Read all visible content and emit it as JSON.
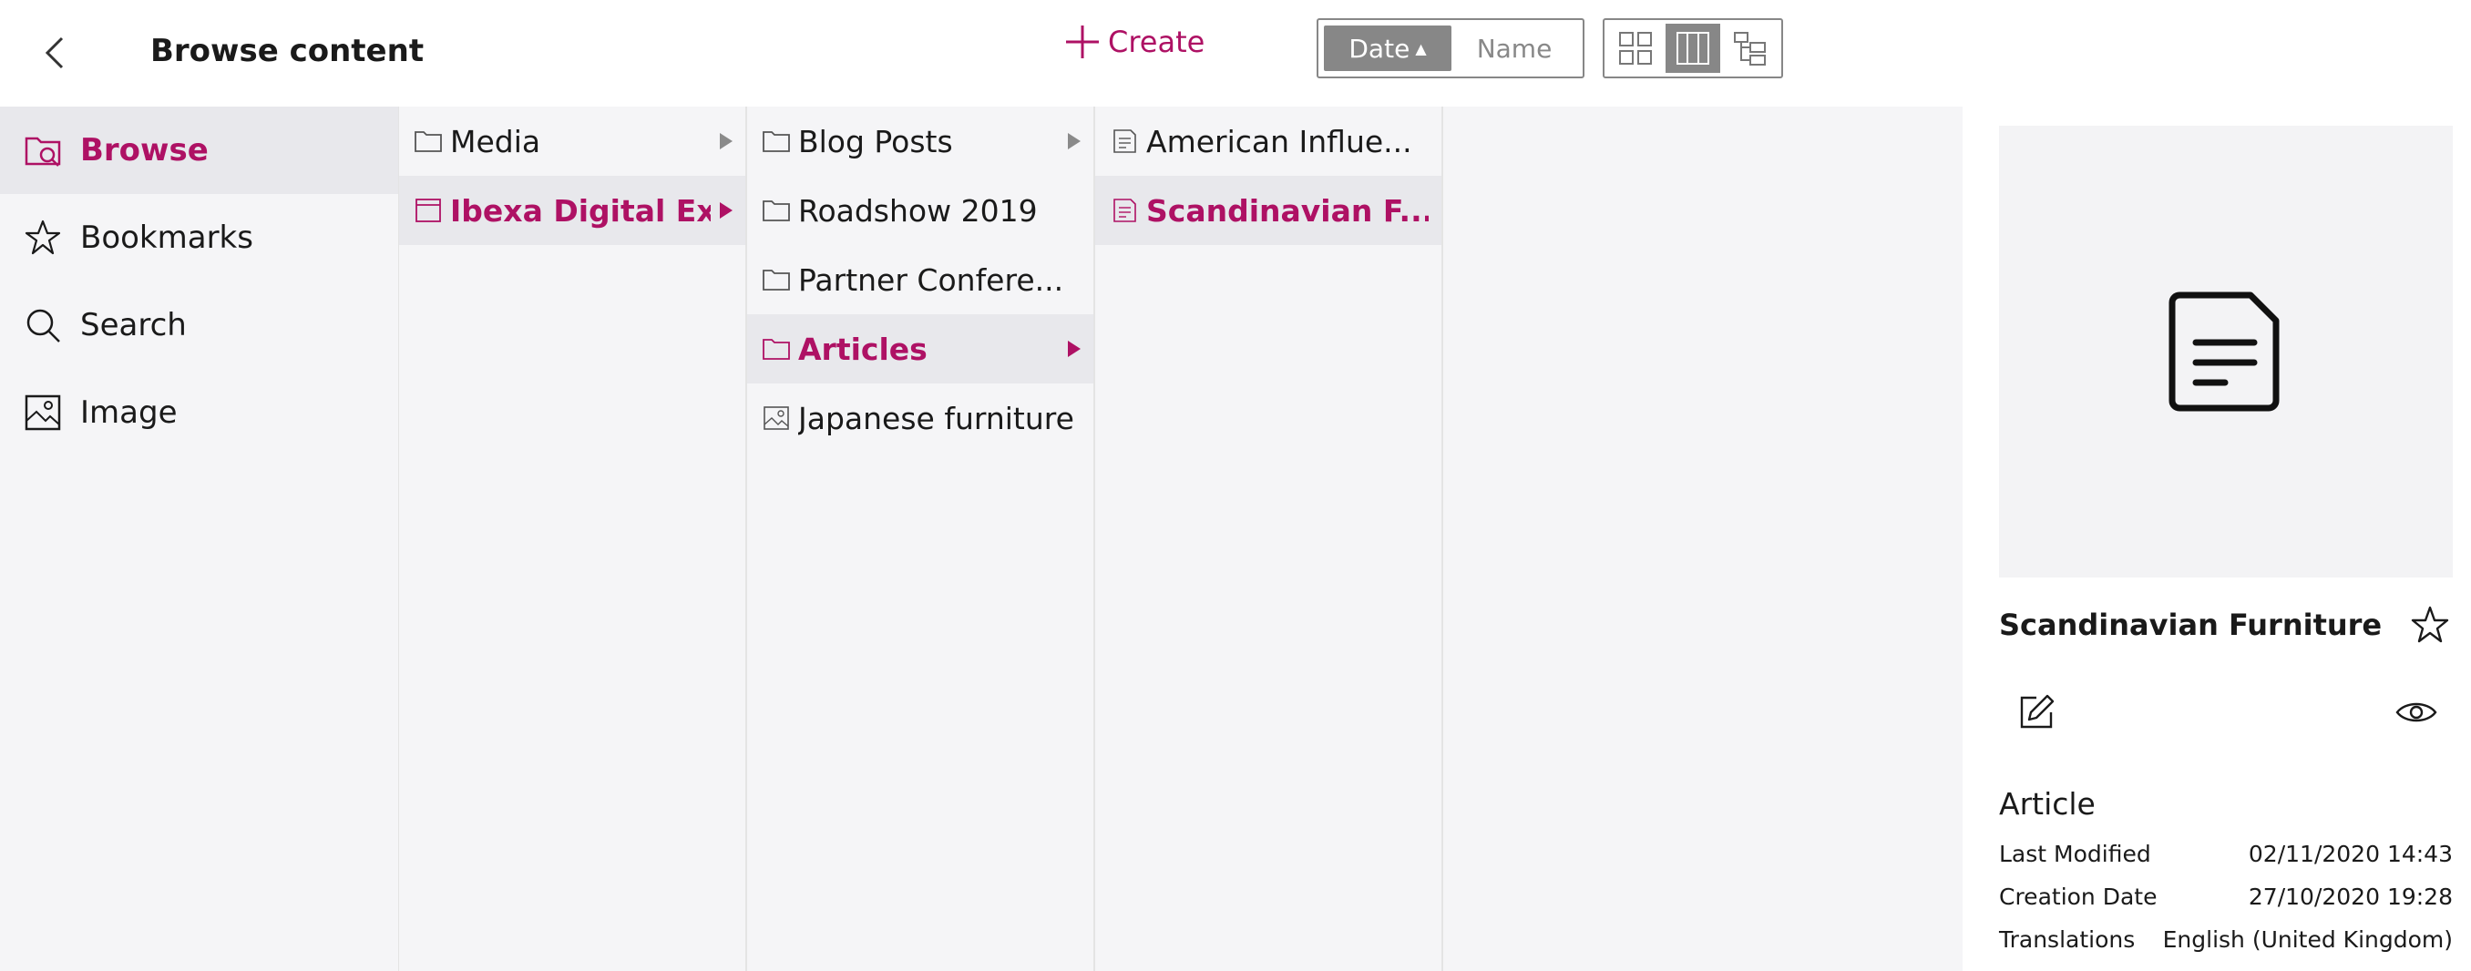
{
  "header": {
    "title": "Browse content",
    "create_label": "Create",
    "sort": {
      "date_label": "Date",
      "date_indicator": "▲",
      "name_label": "Name"
    },
    "view_modes": [
      "grid-view-icon",
      "finder-view-icon",
      "tree-view-icon"
    ],
    "active_view": "finder-view-icon"
  },
  "sidebar": {
    "items": [
      {
        "label": "Browse",
        "icon": "browse-icon",
        "active": true
      },
      {
        "label": "Bookmarks",
        "icon": "star-icon",
        "active": false
      },
      {
        "label": "Search",
        "icon": "search-icon",
        "active": false
      },
      {
        "label": "Image",
        "icon": "image-icon",
        "active": false
      }
    ]
  },
  "columns": [
    {
      "items": [
        {
          "label": "Media",
          "icon": "folder-icon",
          "has_children": true,
          "active": false
        },
        {
          "label": "Ibexa Digital Ex...",
          "icon": "landing-page-icon",
          "has_children": true,
          "active": true
        }
      ]
    },
    {
      "items": [
        {
          "label": "Blog Posts",
          "icon": "folder-icon",
          "has_children": true,
          "active": false
        },
        {
          "label": "Roadshow 2019",
          "icon": "folder-icon",
          "has_children": false,
          "active": false
        },
        {
          "label": "Partner Confere...",
          "icon": "folder-icon",
          "has_children": false,
          "active": false
        },
        {
          "label": "Articles",
          "icon": "folder-icon",
          "has_children": true,
          "active": true
        },
        {
          "label": "Japanese furniture",
          "icon": "image-icon",
          "has_children": false,
          "active": false
        }
      ]
    },
    {
      "items": [
        {
          "label": "American Influe...",
          "icon": "article-icon",
          "has_children": false,
          "active": false
        },
        {
          "label": "Scandinavian F...",
          "icon": "article-icon",
          "has_children": false,
          "active": true
        }
      ]
    }
  ],
  "details": {
    "name": "Scandinavian Furniture",
    "content_type": "Article",
    "meta": [
      {
        "label": "Last Modified",
        "value": "02/11/2020 14:43"
      },
      {
        "label": "Creation Date",
        "value": "27/10/2020 19:28"
      },
      {
        "label": "Translations",
        "value": "English (United Kingdom)"
      }
    ]
  },
  "colors": {
    "accent": "#ae1164",
    "panel_bg": "#f5f5f7",
    "active_bg": "#e8e8ec",
    "toggle_active": "#878787"
  }
}
